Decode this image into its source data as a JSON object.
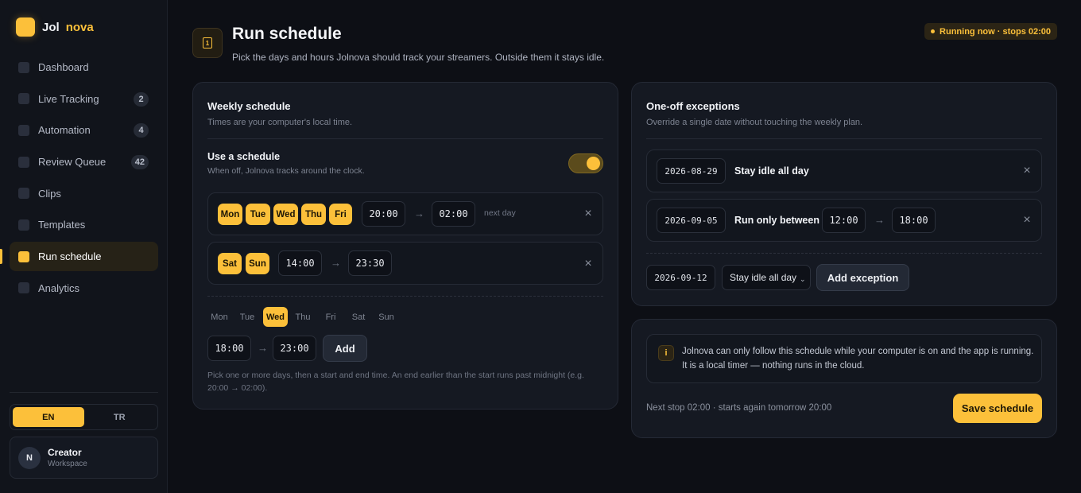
{
  "brand": {
    "name_a": "Jol",
    "name_b": "nova"
  },
  "nav": [
    {
      "label": "Dashboard",
      "badge": ""
    },
    {
      "label": "Live Tracking",
      "badge": "2"
    },
    {
      "label": "Automation",
      "badge": "4"
    },
    {
      "label": "Review Queue",
      "badge": "42"
    },
    {
      "label": "Clips",
      "badge": ""
    },
    {
      "label": "Templates",
      "badge": ""
    },
    {
      "label": "Run schedule",
      "badge": "",
      "active": true
    },
    {
      "label": "Analytics",
      "badge": ""
    }
  ],
  "lang": {
    "en": "EN",
    "tr": "TR",
    "selected": "EN"
  },
  "profile": {
    "initial": "N",
    "name": "Creator",
    "sub": "Workspace"
  },
  "header": {
    "title": "Run schedule",
    "subtitle": "Pick the days and hours Jolnova should track your streamers. Outside them it stays idle.",
    "status": "Running now · stops 02:00"
  },
  "weekly": {
    "title": "Weekly schedule",
    "subtitle": "Times are your computer's local time.",
    "use_label": "Use a schedule",
    "use_sub": "When off, Jolnova tracks around the clock.",
    "use_enabled": true,
    "rows": [
      {
        "days": [
          "Mon",
          "Tue",
          "Wed",
          "Thu",
          "Fri"
        ],
        "start": "20:00",
        "end": "02:00",
        "note": "next day"
      },
      {
        "days": [
          "Sat",
          "Sun"
        ],
        "start": "14:00",
        "end": "23:30",
        "note": ""
      }
    ],
    "picker_days": [
      "Mon",
      "Tue",
      "Wed",
      "Thu",
      "Fri",
      "Sat",
      "Sun"
    ],
    "picker_selected": "Wed",
    "new_start": "18:00",
    "new_end": "23:00",
    "add_label": "Add",
    "hint": "Pick one or more days, then a start and end time. An end earlier than the start runs past midnight (e.g. 20:00 → 02:00)."
  },
  "exceptions": {
    "title": "One-off exceptions",
    "subtitle": "Override a single date without touching the weekly plan.",
    "items": [
      {
        "date": "2026-08-29",
        "label": "Stay idle all day"
      },
      {
        "date": "2026-09-05",
        "label": "Run only between",
        "start": "12:00",
        "end": "18:00"
      }
    ],
    "new_date": "2026-09-12",
    "new_mode": "Stay idle all day",
    "add_label": "Add exception"
  },
  "info": {
    "icon": "i",
    "line1": "Jolnova can only follow this schedule while your computer is on and the app is running.",
    "line2": "It is a local timer — nothing runs in the cloud."
  },
  "footer": {
    "next": "Next stop 02:00 · starts again tomorrow 20:00",
    "save_label": "Save schedule"
  },
  "glyphs": {
    "arrow": "→",
    "close": "×",
    "chevron": "⌄",
    "calendar": "1"
  },
  "colors": {
    "accent": "#fcc03a",
    "bg": "#0d0f15",
    "card": "#151922"
  }
}
